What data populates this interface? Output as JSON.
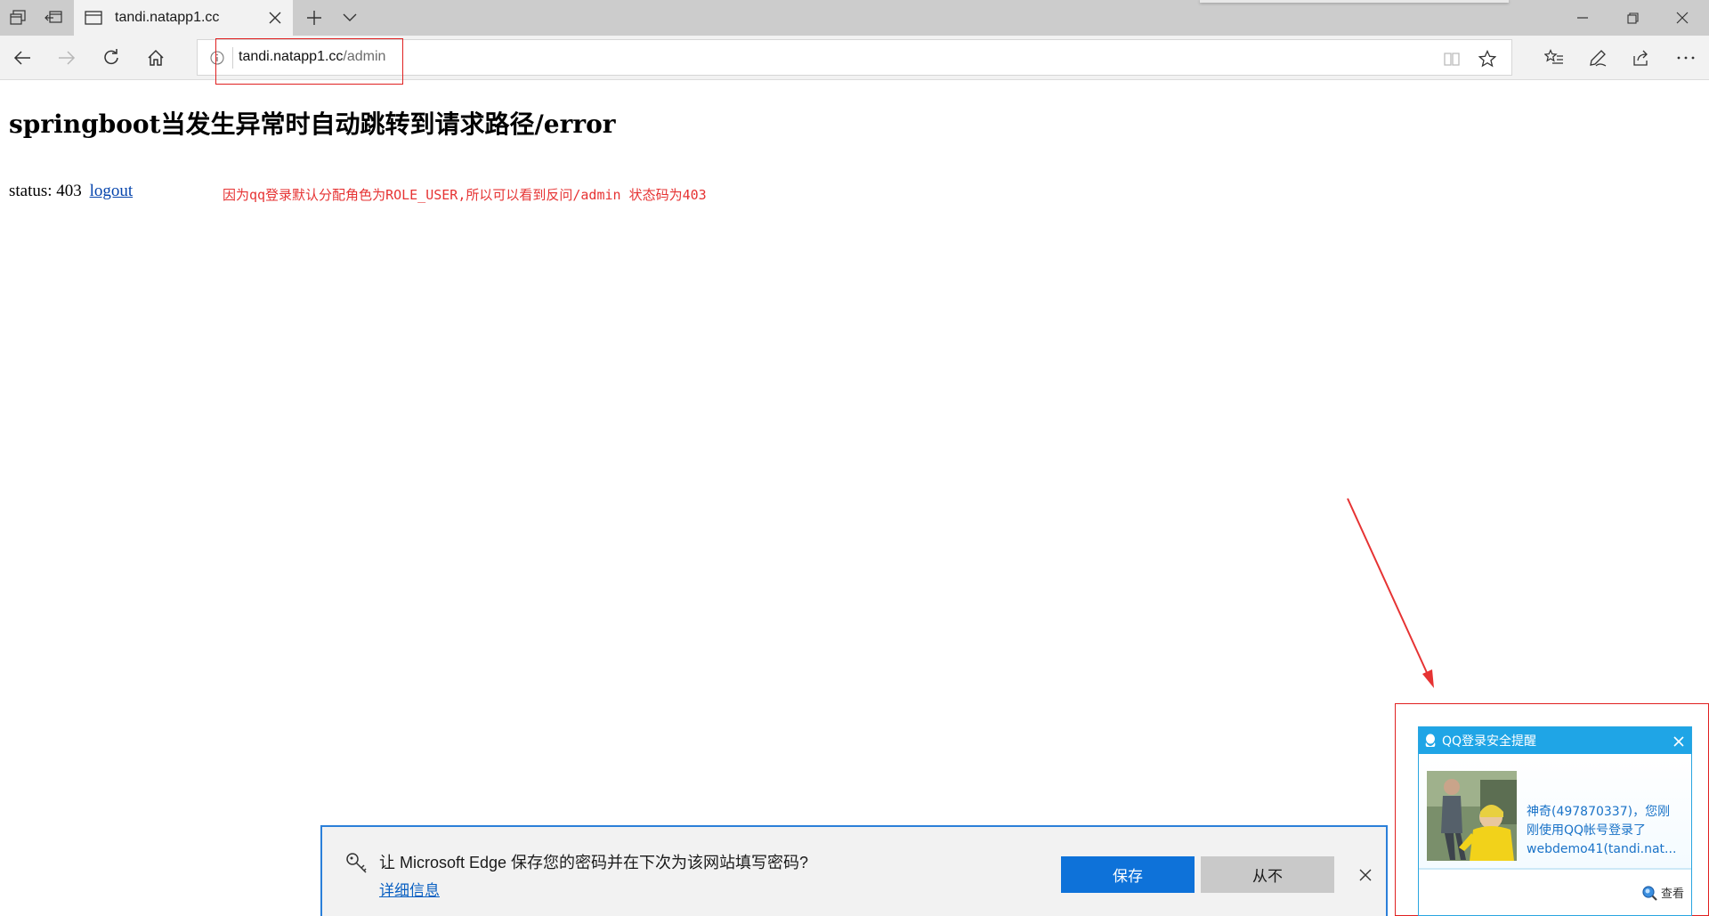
{
  "browser": {
    "tab": {
      "title": "tandi.natapp1.cc"
    },
    "address": {
      "host": "tandi.natapp1.cc",
      "path": "/admin"
    },
    "icons": {
      "tab_preview": "tab-preview-icon",
      "set_tabs_aside": "set-tabs-aside-icon",
      "tab_page": "tab-page-icon",
      "tab_close": "close-icon",
      "new_tab": "plus-icon",
      "tab_list": "chevron-down-icon",
      "minimize": "minimize-icon",
      "restore": "restore-icon",
      "close_window": "close-icon",
      "back": "back-arrow-icon",
      "forward": "forward-arrow-icon",
      "refresh": "refresh-icon",
      "home": "home-icon",
      "site_info": "info-icon",
      "reading_view": "reading-view-icon",
      "favorite": "star-icon",
      "favorites_hub": "favorites-list-icon",
      "web_note": "pen-icon",
      "share": "share-icon",
      "more": "more-icon"
    }
  },
  "page": {
    "heading": "springboot当发生异常时自动跳转到请求路径/error",
    "status_label": "status: 403",
    "logout_link": "logout",
    "annotation": "因为qq登录默认分配角色为ROLE_USER,所以可以看到反问/admin 状态码为403",
    "annotation_color": "#e63333"
  },
  "qq_popup": {
    "title": "QQ登录安全提醒",
    "message_lines": [
      "神奇(497870337)，您刚",
      "刚使用QQ帐号登录了",
      "webdemo41(tandi.nat..."
    ],
    "view_label": "查看",
    "accent_color": "#1fa5e6"
  },
  "password_prompt": {
    "question": "让 Microsoft Edge 保存您的密码并在下次为该网站填写密码?",
    "more_info": "详细信息",
    "save_label": "保存",
    "never_label": "从不",
    "accent_color": "#0e72d9"
  }
}
